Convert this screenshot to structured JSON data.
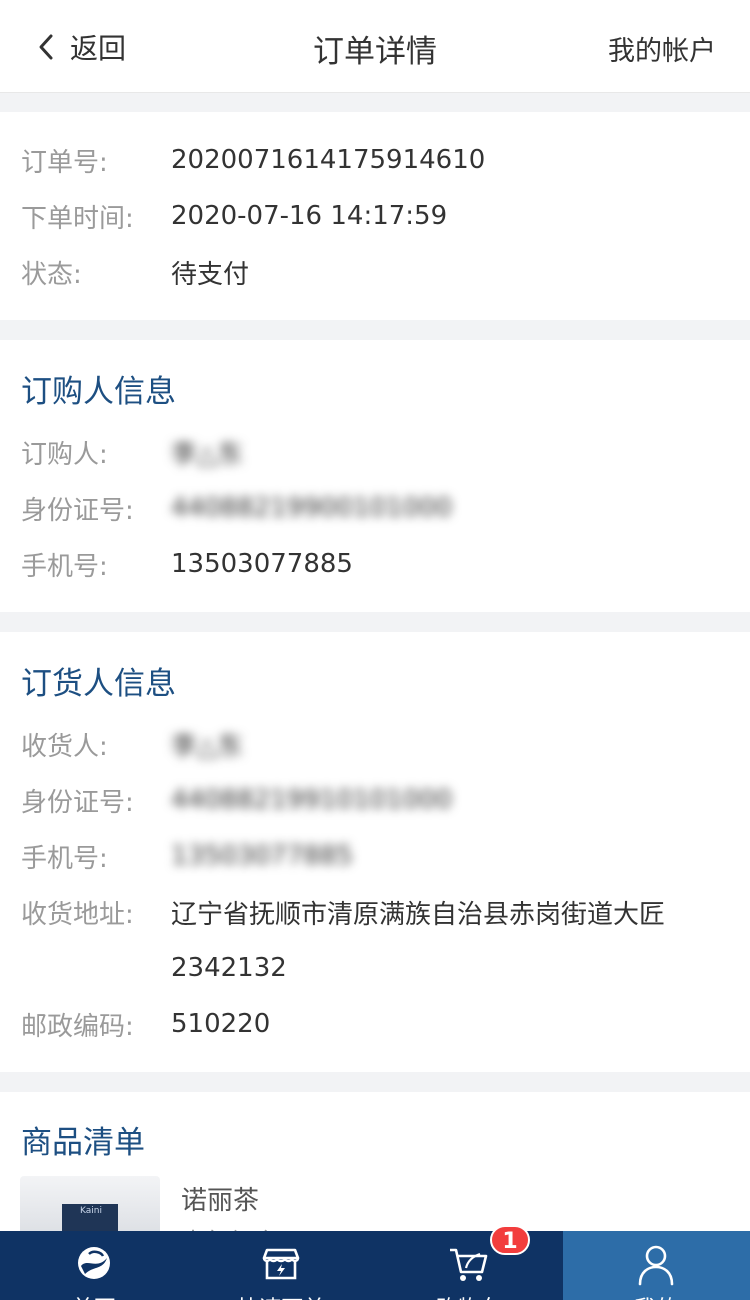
{
  "header": {
    "back_label": "返回",
    "title": "订单详情",
    "account_label": "我的帐户"
  },
  "order": {
    "number_label": "订单号:",
    "number": "2020071614175914610",
    "time_label": "下单时间:",
    "time": "2020-07-16 14:17:59",
    "status_label": "状态:",
    "status": "待支付"
  },
  "buyer": {
    "title": "订购人信息",
    "name_label": "订购人:",
    "name": "李△东",
    "id_label": "身份证号:",
    "id": "44088219900101000",
    "phone_label": "手机号:",
    "phone": "13503077885"
  },
  "receiver": {
    "title": "订货人信息",
    "name_label": "收货人:",
    "name": "李△东",
    "id_label": "身份证号:",
    "id": "44088219910101000",
    "phone_label": "手机号:",
    "phone": "13503077885",
    "address_label": "收货地址:",
    "address_line1": "辽宁省抚顺市清原满族自治县赤岗街道大匠",
    "address_line2": "2342132",
    "zip_label": "邮政编码:",
    "zip": "510220"
  },
  "goods": {
    "title": "商品清单",
    "item_name": "诺丽茶",
    "item_sub": "十年组合",
    "thumb_text": "Kaini"
  },
  "tabbar": {
    "tabs": [
      {
        "label": "首页",
        "icon": "home-logo-icon"
      },
      {
        "label": "快速下单",
        "icon": "quick-order-icon"
      },
      {
        "label": "购物车",
        "icon": "cart-icon"
      },
      {
        "label": "我的",
        "icon": "user-icon"
      }
    ],
    "cart_badge": "1"
  },
  "colors": {
    "tabbar_bg": "#0f3364",
    "tab_active_bg": "#2d6da8",
    "section_title": "#1d4f82",
    "badge": "#f23d3d"
  }
}
